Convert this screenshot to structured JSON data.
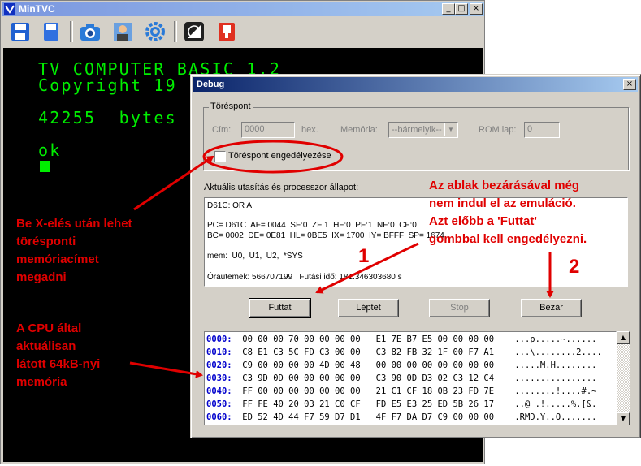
{
  "main_window": {
    "title": "MinTVC",
    "min_label": "_",
    "max_label": "□",
    "close_label": "×",
    "toolbar_icons": [
      "save-icon",
      "floppy-icon",
      "camera-icon",
      "profile-icon",
      "gear-icon",
      "contrast-icon",
      "bookmark-icon"
    ]
  },
  "tv_screen": {
    "lines": [
      "TV COMPUTER BASIC 1.2",
      "Copyright 19",
      "42255  bytes",
      "ok"
    ]
  },
  "debug": {
    "title": "Debug",
    "close_label": "×",
    "breakpoint_group": "Töréspont",
    "address_label": "Cím:",
    "address_value": "0000",
    "hex_label": "hex.",
    "memory_label": "Memória:",
    "memory_value": "--bármelyik--",
    "rom_label": "ROM lap:",
    "rom_value": "0",
    "enable_checkbox_label": "Töréspont engedélyezése",
    "state_label": "Aktuális utasítás és processzor állapot:",
    "state_lines": [
      "D61C: OR A",
      "",
      "PC= D61C  AF= 0044  SF:0  ZF:1  HF:0  PF:1  NF:0  CF:0",
      "BC= 0002  DE= 0E81  HL= 0BE5  IX= 1700  IY= BFFF  SP= 1674",
      "",
      "mem:  U0,  U1,  U2,  *SYS",
      "",
      "Óraütemek: 566707199   Futási idő: 181.346303680 s"
    ],
    "buttons": {
      "run": "Futtat",
      "step": "Léptet",
      "stop": "Stop",
      "close": "Bezár"
    },
    "memory_rows": [
      {
        "addr": "0000:",
        "bytes": "00 00 00 70 00 00 00 00   E1 7E B7 E5 00 00 00 00",
        "ascii": "...p.....~......"
      },
      {
        "addr": "0010:",
        "bytes": "C8 E1 C3 5C FD C3 00 00   C3 82 FB 32 1F 00 F7 A1",
        "ascii": "...\\........2...."
      },
      {
        "addr": "0020:",
        "bytes": "C9 00 00 00 00 4D 00 48   00 00 00 00 00 00 00 00",
        "ascii": ".....M.H........"
      },
      {
        "addr": "0030:",
        "bytes": "C3 9D 0D 00 00 00 00 00   C3 90 0D D3 02 C3 12 C4",
        "ascii": "................"
      },
      {
        "addr": "0040:",
        "bytes": "FF 00 00 00 00 00 00 00   21 C1 CF 18 0B 23 FD 7E",
        "ascii": "........!....#.~"
      },
      {
        "addr": "0050:",
        "bytes": "FF FE 40 20 03 21 C0 CF   FD E5 E3 25 ED 5B 26 17",
        "ascii": "..@ .!.....%.[&."
      },
      {
        "addr": "0060:",
        "bytes": "ED 52 4D 44 F7 59 D7 D1   4F F7 DA D7 C9 00 00 00",
        "ascii": ".RMD.Y..O......."
      }
    ],
    "scroll_up": "▲",
    "scroll_down": "▼"
  },
  "annotations": {
    "breakpoint_note": [
      "Be X-elés után lehet",
      "törésponti",
      "memóriacímet",
      "megadni"
    ],
    "memory_note": [
      "A CPU által",
      "aktuálisan",
      "látott 64kB-nyi",
      "memória"
    ],
    "close_note": [
      "Az ablak bezárásával még",
      "nem indul el az emuláció.",
      "Azt előbb a 'Futtat'",
      "gombbal kell engedélyezni."
    ],
    "num_1": "1",
    "num_2": "2"
  },
  "colors": {
    "tv_text": "#00ee00",
    "annotation": "#e00000",
    "mem_address": "#0000cc"
  }
}
